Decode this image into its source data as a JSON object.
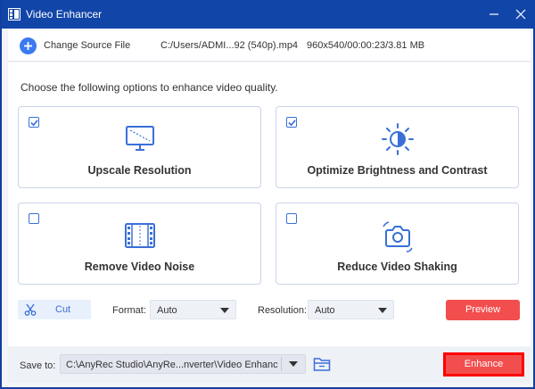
{
  "window": {
    "title": "Video Enhancer",
    "icon": "film-grid-icon"
  },
  "source": {
    "change_label": "Change Source File",
    "file_path": "C:/Users/ADMI...92 (540p).mp4",
    "file_info": "960x540/00:00:23/3.81 MB"
  },
  "main": {
    "instruction": "Choose the following options to enhance video quality.",
    "options": [
      {
        "label": "Upscale Resolution",
        "checked": true,
        "icon": "monitor-icon"
      },
      {
        "label": "Optimize Brightness and Contrast",
        "checked": true,
        "icon": "brightness-icon"
      },
      {
        "label": "Remove Video Noise",
        "checked": false,
        "icon": "film-strip-icon"
      },
      {
        "label": "Reduce Video Shaking",
        "checked": false,
        "icon": "stabilize-camera-icon"
      }
    ]
  },
  "controls": {
    "cut_label": "Cut",
    "format_label": "Format:",
    "format_value": "Auto",
    "resolution_label": "Resolution:",
    "resolution_value": "Auto",
    "preview_label": "Preview"
  },
  "footer": {
    "save_label": "Save to:",
    "save_path": "C:\\AnyRec Studio\\AnyRe...nverter\\Video Enhancer",
    "enhance_label": "Enhance"
  },
  "colors": {
    "titlebar": "#1245a8",
    "accent": "#3a7af2",
    "primary_button": "#f24e4e",
    "highlight_border": "#ff0000"
  }
}
